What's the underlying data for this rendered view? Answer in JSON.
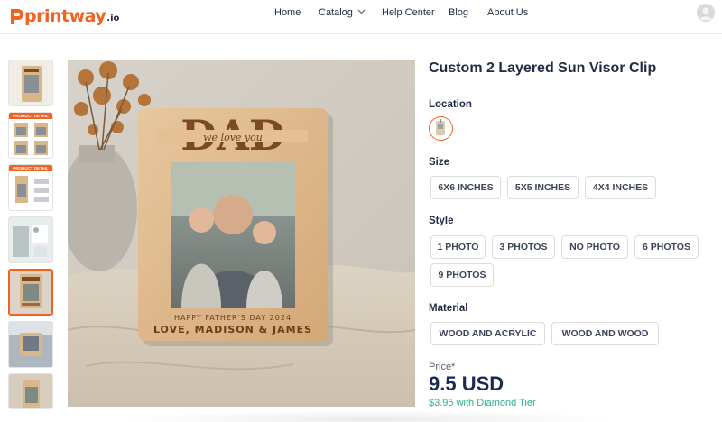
{
  "brand": {
    "name": "printway",
    "suffix": ".io",
    "accent": "#f26322"
  },
  "nav": {
    "home": "Home",
    "catalog": "Catalog",
    "help_center": "Help Center",
    "blog": "Blog",
    "about_us": "About Us"
  },
  "icons": {
    "catalog_dropdown": "chevron-down-icon",
    "account": "user-avatar-icon"
  },
  "gallery": {
    "thumbnail_count": 7,
    "active_index": 4,
    "thumb_labels": [
      "PRODUCT DETAIL",
      "PRODUCT DETAIL"
    ]
  },
  "main_image": {
    "frame_title": "DAD",
    "frame_script": "we love you",
    "frame_line1": "HAPPY FATHER'S DAY 2024",
    "frame_line2": "LOVE, MADISON & JAMES"
  },
  "product": {
    "title": "Custom 2 Layered Sun Visor Clip",
    "location_label": "Location",
    "size_label": "Size",
    "sizes": [
      "6X6 INCHES",
      "5X5 INCHES",
      "4X4 INCHES"
    ],
    "style_label": "Style",
    "styles": [
      "1 PHOTO",
      "3 PHOTOS",
      "NO PHOTO",
      "6 PHOTOS",
      "9 PHOTOS"
    ],
    "material_label": "Material",
    "materials": [
      "WOOD AND ACRYLIC",
      "WOOD AND WOOD"
    ],
    "price_label": "Price*",
    "price": "9.5 USD",
    "tier_price": "$3.95 with Diamond Tier",
    "tier_color": "#2fae8f"
  }
}
